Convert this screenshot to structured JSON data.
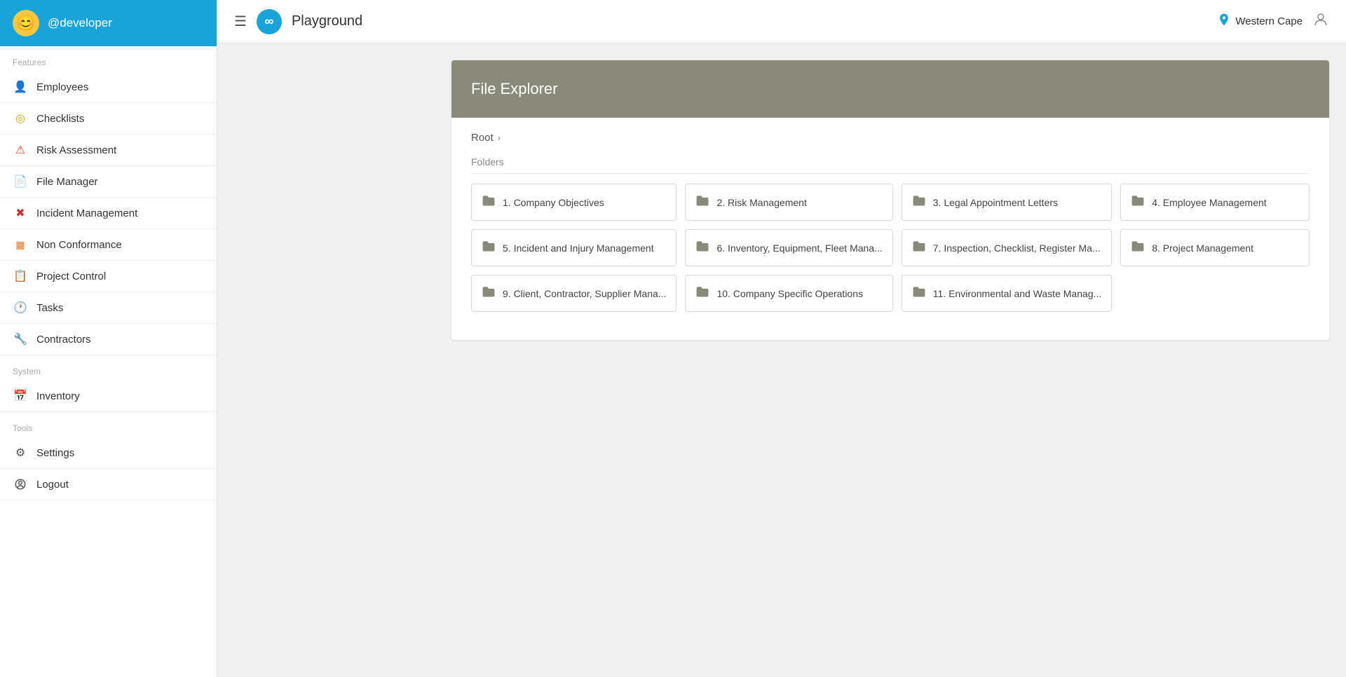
{
  "sidebar": {
    "username": "@developer",
    "avatar_emoji": "😊",
    "sections": [
      {
        "label": "Features",
        "items": [
          {
            "id": "employees",
            "label": "Employees",
            "icon": "👤",
            "icon_color": "#1aa3d9"
          },
          {
            "id": "checklists",
            "label": "Checklists",
            "icon": "◎",
            "icon_color": "#e8a020"
          },
          {
            "id": "risk-assessment",
            "label": "Risk Assessment",
            "icon": "⚠",
            "icon_color": "#e05020"
          },
          {
            "id": "file-manager",
            "label": "File Manager",
            "icon": "📄",
            "icon_color": "#888"
          },
          {
            "id": "incident-management",
            "label": "Incident Management",
            "icon": "✖",
            "icon_color": "#cc3030"
          },
          {
            "id": "non-conformance",
            "label": "Non Conformance",
            "icon": "▦",
            "icon_color": "#e07020"
          },
          {
            "id": "project-control",
            "label": "Project Control",
            "icon": "📋",
            "icon_color": "#2a9a2a"
          },
          {
            "id": "tasks",
            "label": "Tasks",
            "icon": "🕐",
            "icon_color": "#3a6acc"
          },
          {
            "id": "contractors",
            "label": "Contractors",
            "icon": "🔧",
            "icon_color": "#2a9aaa"
          }
        ]
      },
      {
        "label": "System",
        "items": [
          {
            "id": "inventory",
            "label": "Inventory",
            "icon": "📅",
            "icon_color": "#1a7acc"
          }
        ]
      },
      {
        "label": "Tools",
        "items": [
          {
            "id": "settings",
            "label": "Settings",
            "icon": "⚙",
            "icon_color": "#555"
          },
          {
            "id": "logout",
            "label": "Logout",
            "icon": "👁",
            "icon_color": "#555"
          }
        ]
      }
    ]
  },
  "topbar": {
    "menu_label": "☰",
    "logo_symbol": "∞",
    "title": "Playground",
    "location": "Western Cape",
    "location_icon": "👤"
  },
  "file_explorer": {
    "header_title": "File Explorer",
    "breadcrumb_root": "Root",
    "folders_label": "Folders",
    "folders": [
      {
        "id": "folder-1",
        "name": "1. Company Objectives"
      },
      {
        "id": "folder-2",
        "name": "2. Risk Management"
      },
      {
        "id": "folder-3",
        "name": "3. Legal Appointment Letters"
      },
      {
        "id": "folder-4",
        "name": "4.  Employee Management"
      },
      {
        "id": "folder-5",
        "name": "5. Incident and Injury Management"
      },
      {
        "id": "folder-6",
        "name": "6. Inventory, Equipment, Fleet Mana..."
      },
      {
        "id": "folder-7",
        "name": "7. Inspection, Checklist, Register Ma..."
      },
      {
        "id": "folder-8",
        "name": "8.  Project Management"
      },
      {
        "id": "folder-9",
        "name": "9. Client, Contractor, Supplier Mana..."
      },
      {
        "id": "folder-10",
        "name": "10. Company Specific Operations"
      },
      {
        "id": "folder-11",
        "name": "11. Environmental and Waste Manag..."
      }
    ]
  }
}
